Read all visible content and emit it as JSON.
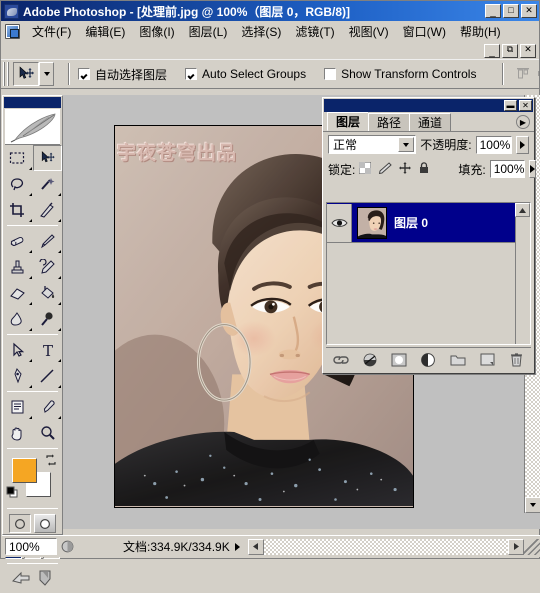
{
  "window": {
    "app_title": "Adobe Photoshop - [处理前.jpg @ 100%（图层 0，RGB/8)]",
    "minimize": "_",
    "maximize": "□",
    "close": "✕",
    "child_minimize": "_",
    "child_restore": "⧉",
    "child_close": "✕"
  },
  "menubar": {
    "items": [
      {
        "label": "文件(F)"
      },
      {
        "label": "编辑(E)"
      },
      {
        "label": "图像(I)"
      },
      {
        "label": "图层(L)"
      },
      {
        "label": "选择(S)"
      },
      {
        "label": "滤镜(T)"
      },
      {
        "label": "视图(V)"
      },
      {
        "label": "窗口(W)"
      },
      {
        "label": "帮助(H)"
      }
    ]
  },
  "options_bar": {
    "tool": "move-tool",
    "checkboxes": [
      {
        "label": "自动选择图层",
        "checked": true
      },
      {
        "label": "Auto Select Groups",
        "checked": true
      },
      {
        "label": "Show Transform Controls",
        "checked": false
      }
    ],
    "align_icons": [
      "align-top-edges",
      "align-vertical-centers",
      "align-bottom-edges"
    ]
  },
  "toolbox": {
    "tools": [
      "rectangular-marquee-tool",
      "move-tool",
      "lasso-tool",
      "magic-wand-tool",
      "crop-tool",
      "slice-tool",
      "healing-brush-tool",
      "brush-tool",
      "clone-stamp-tool",
      "history-brush-tool",
      "eraser-tool",
      "paint-bucket-tool",
      "blur-tool",
      "dodge-tool",
      "path-selection-tool",
      "type-tool",
      "pen-tool",
      "line-tool",
      "notes-tool",
      "eyedropper-tool",
      "hand-tool",
      "zoom-tool"
    ],
    "foreground_color": "#f5a623",
    "background_color": "#ffffff",
    "quick_mask_modes": [
      "standard-mode",
      "quick-mask-mode"
    ],
    "screen_modes": [
      "standard-screen-mode",
      "full-screen-with-menubar",
      "full-screen-mode"
    ],
    "jump_to": [
      "jump-to-imageready",
      "jump-to-illustrator"
    ]
  },
  "document": {
    "watermark": "宇夜苍穹出品",
    "filename": "处理前.jpg",
    "zoom": "100%"
  },
  "layers_panel": {
    "tabs": [
      {
        "label": "图层",
        "active": true
      },
      {
        "label": "路径",
        "active": false
      },
      {
        "label": "通道",
        "active": false
      }
    ],
    "menu_button": "▶",
    "blend_mode": "正常",
    "opacity_label": "不透明度:",
    "opacity_value": "100%",
    "lock_label": "锁定:",
    "lock_icons": [
      "lock-transparent-pixels",
      "lock-image-pixels",
      "lock-position",
      "lock-all"
    ],
    "fill_label": "填充:",
    "fill_value": "100%",
    "layers": [
      {
        "name": "图层 0",
        "visible": true,
        "selected": true
      }
    ],
    "footer_buttons": [
      "link-layers-icon",
      "layer-style-icon",
      "add-layer-mask-icon",
      "new-adjustment-layer-icon",
      "new-group-icon",
      "new-layer-icon",
      "delete-layer-icon"
    ]
  },
  "statusbar": {
    "zoom": "100%",
    "doc_info": "文档:334.9K/334.9K",
    "proxy_icon": "preview-icon",
    "expand_arrow": "▶"
  }
}
